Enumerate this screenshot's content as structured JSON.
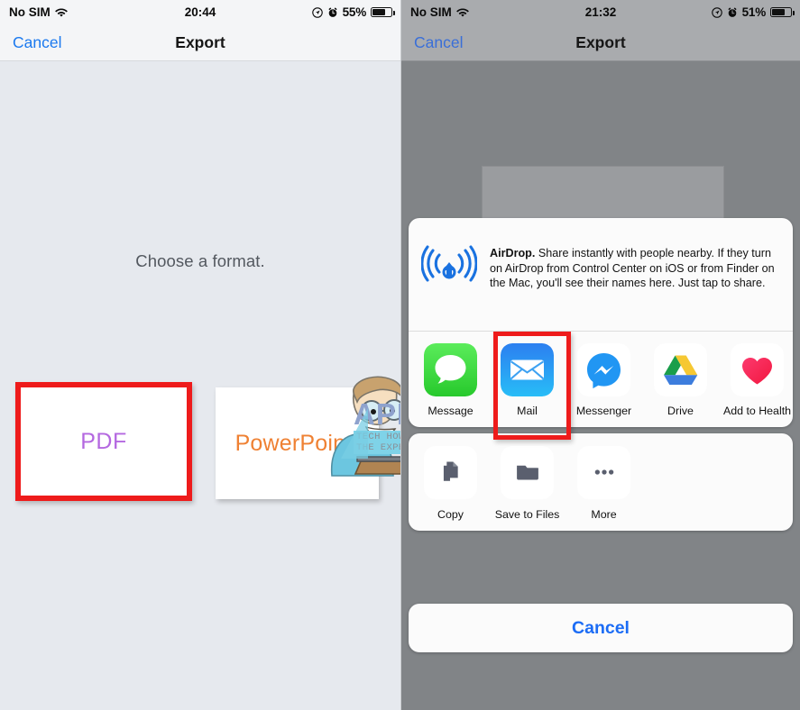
{
  "left": {
    "status": {
      "carrier": "No SIM",
      "wifi_icon": "wifi-icon",
      "time": "20:44",
      "location_icon": "location-icon",
      "alarm_icon": "alarm-clock-icon",
      "battery_percent": "55%",
      "battery_icon": "battery-icon"
    },
    "nav": {
      "cancel_label": "Cancel",
      "title": "Export"
    },
    "prompt": "Choose a format.",
    "formats": [
      {
        "label": "PDF",
        "color": "#b468e0",
        "highlighted": true
      },
      {
        "label": "PowerPoint",
        "color": "#ef8133",
        "highlighted": false
      }
    ]
  },
  "watermark": {
    "brand": "APPUALS",
    "tagline_line1": "TECH HOW-TO'S FROM",
    "tagline_line2": "THE EXPERTS!",
    "cartoon_icon": "cartoon-person-laptop-icon"
  },
  "right": {
    "status": {
      "carrier": "No SIM",
      "wifi_icon": "wifi-icon",
      "time": "21:32",
      "location_icon": "location-icon",
      "alarm_icon": "alarm-clock-icon",
      "battery_percent": "51%",
      "battery_icon": "battery-icon"
    },
    "nav": {
      "cancel_label": "Cancel",
      "title": "Export"
    },
    "share_sheet": {
      "airdrop": {
        "icon": "airdrop-icon",
        "title": "AirDrop.",
        "description": " Share instantly with people nearby. If they turn on AirDrop from Control Center on iOS or from Finder on the Mac, you'll see their names here. Just tap to share."
      },
      "apps": [
        {
          "label": "Message",
          "icon": "messages-icon",
          "highlighted": false
        },
        {
          "label": "Mail",
          "icon": "mail-icon",
          "highlighted": true
        },
        {
          "label": "Messenger",
          "icon": "messenger-icon",
          "highlighted": false
        },
        {
          "label": "Drive",
          "icon": "google-drive-icon",
          "highlighted": false
        },
        {
          "label": "Add to Health",
          "icon": "health-heart-icon",
          "highlighted": false
        }
      ],
      "actions": [
        {
          "label": "Copy",
          "icon": "copy-icon"
        },
        {
          "label": "Save to Files",
          "icon": "folder-icon"
        },
        {
          "label": "More",
          "icon": "ellipsis-icon"
        }
      ],
      "cancel_label": "Cancel"
    }
  },
  "colors": {
    "accent_blue": "#1b6cf5",
    "highlight_red": "#ee1b1b",
    "pdf_purple": "#b468e0",
    "powerpoint_orange": "#ef8133"
  }
}
